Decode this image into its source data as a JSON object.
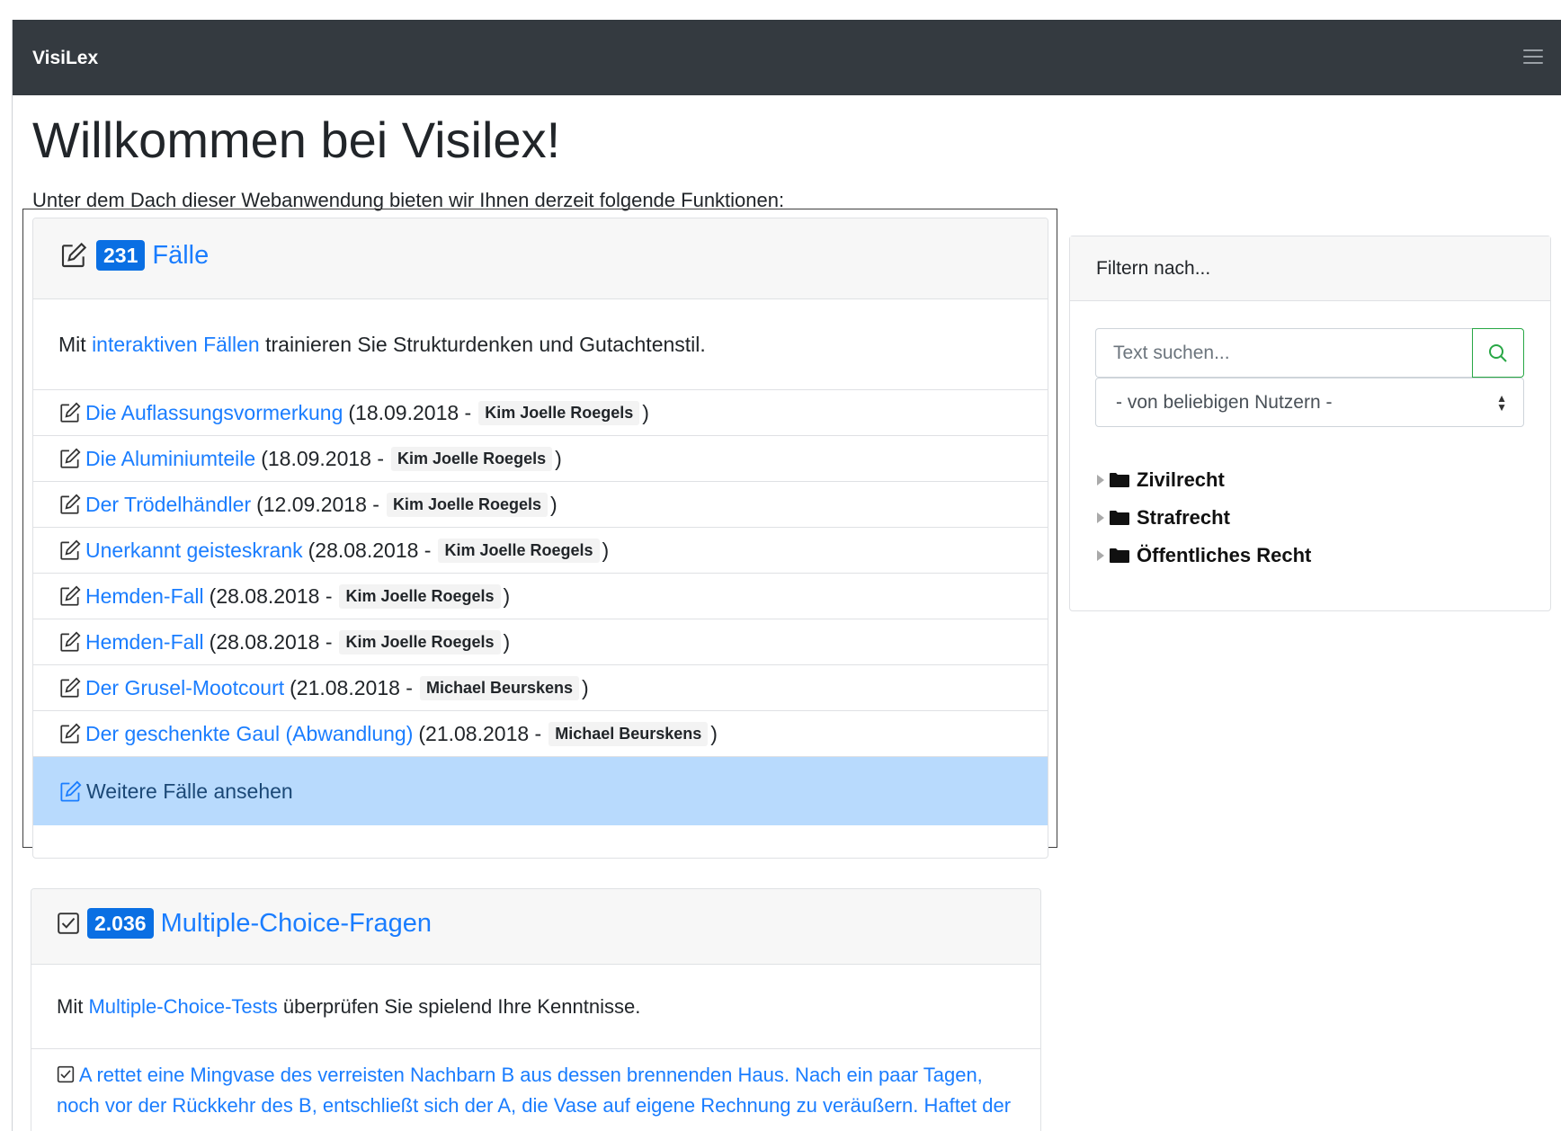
{
  "navbar": {
    "brand": "VisiLex",
    "menu_icon": "hamburger-icon"
  },
  "page": {
    "title": "Willkommen bei Visilex!",
    "intro": "Unter dem Dach dieser Webanwendung bieten wir Ihnen derzeit folgende Funktionen:"
  },
  "cases_card": {
    "icon": "edit-icon",
    "count": "231",
    "title": "Fälle",
    "body_prefix": "Mit ",
    "body_link": "interaktiven Fällen",
    "body_suffix": " trainieren Sie Strukturdenken und Gutachtenstil.",
    "items": [
      {
        "title": "Die Auflassungsvormerkung",
        "date": "(18.09.2018 -",
        "author": "Kim Joelle Roegels",
        "close": ")"
      },
      {
        "title": "Die Aluminiumteile",
        "date": "(18.09.2018 -",
        "author": "Kim Joelle Roegels",
        "close": ")"
      },
      {
        "title": "Der Trödelhändler",
        "date": "(12.09.2018 -",
        "author": "Kim Joelle Roegels",
        "close": ")"
      },
      {
        "title": "Unerkannt geisteskrank",
        "date": "(28.08.2018 -",
        "author": "Kim Joelle Roegels",
        "close": ")"
      },
      {
        "title": "Hemden-Fall",
        "date": "(28.08.2018 -",
        "author": "Kim Joelle Roegels",
        "close": ")"
      },
      {
        "title": "Hemden-Fall",
        "date": "(28.08.2018 -",
        "author": "Kim Joelle Roegels",
        "close": ")"
      },
      {
        "title": "Der Grusel-Mootcourt",
        "date": "(21.08.2018 -",
        "author": "Michael Beurskens",
        "close": ")"
      },
      {
        "title": "Der geschenkte Gaul (Abwandlung)",
        "date": "(21.08.2018 -",
        "author": "Michael Beurskens",
        "close": ")"
      }
    ],
    "more_label": "Weitere Fälle ansehen"
  },
  "mc_card": {
    "icon": "checkbox-icon",
    "count": "2.036",
    "title": "Multiple-Choice-Fragen",
    "body_prefix": "Mit ",
    "body_link": "Multiple-Choice-Tests",
    "body_suffix": " überprüfen Sie spielend Ihre Kenntnisse.",
    "first_item": "A rettet eine Mingvase des verreisten Nachbarn B aus dessen brennenden Haus. Nach ein paar Tagen, noch vor der Rückkehr des B, entschließt sich der A, die Vase auf eigene Rechnung zu veräußern. Haftet der"
  },
  "filter": {
    "header": "Filtern nach...",
    "search_placeholder": "Text suchen...",
    "search_icon": "search-icon",
    "select_value": "- von beliebigen Nutzern -",
    "tree": [
      {
        "label": "Zivilrecht",
        "icon": "folder-icon"
      },
      {
        "label": "Strafrecht",
        "icon": "folder-icon"
      },
      {
        "label": "Öffentliches Recht",
        "icon": "folder-icon"
      }
    ]
  },
  "colors": {
    "navbar": "#343a40",
    "link": "#1a7dff",
    "badge": "#0a6fe3",
    "more_bg": "#b8dafd",
    "search_border": "#28a745"
  }
}
